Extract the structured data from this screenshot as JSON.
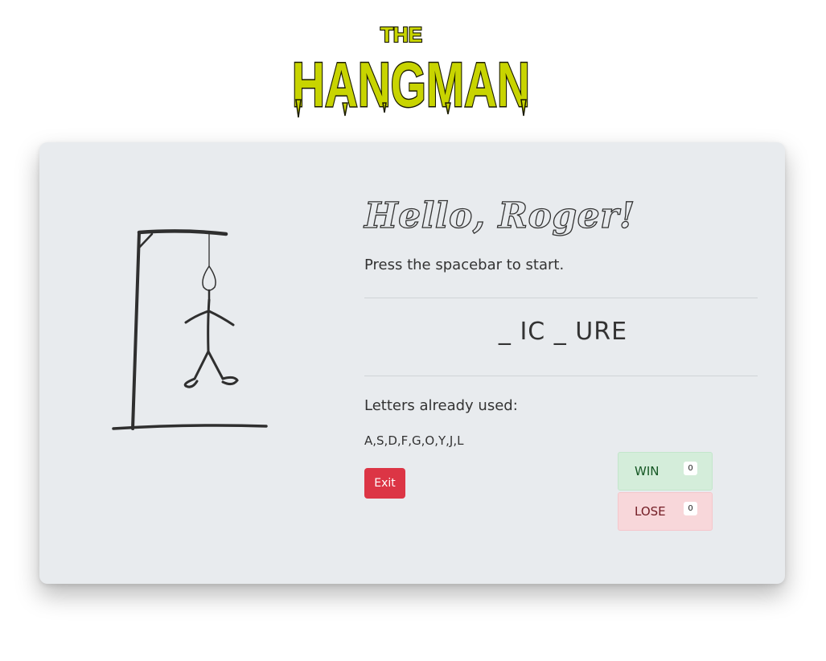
{
  "logo": {
    "small_text": "THE",
    "big_text": "HANGMAN"
  },
  "game": {
    "greeting": "Hello, Roger!",
    "instruction": "Press the spacebar to start.",
    "word_display": "_ IC _ URE",
    "used_label": "Letters already used:",
    "used_letters": "A,S,D,F,G,O,Y,J,L",
    "exit_label": "Exit",
    "wrong_guesses": 6
  },
  "score": {
    "win_label": "WIN",
    "win_count": "0",
    "lose_label": "LOSE",
    "lose_count": "0"
  },
  "colors": {
    "logo_fill": "#c8d400",
    "card_bg": "#e8ebee",
    "exit_bg": "#dc3545",
    "win_bg": "#d4edda",
    "lose_bg": "#f8d7da"
  }
}
